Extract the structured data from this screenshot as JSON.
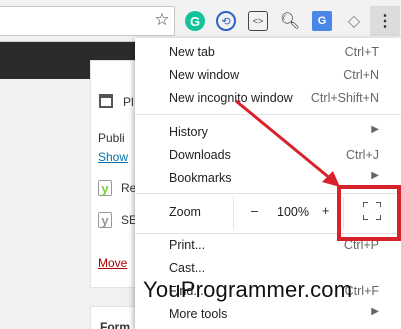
{
  "toolbar": {
    "bookmark_icon": "star-icon",
    "extensions": [
      "grammarly-icon",
      "sync-icon",
      "code-icon",
      "search-icon",
      "translate-icon",
      "tag-icon"
    ],
    "grammarly_letter": "G",
    "menu_icon": "kebab-icon"
  },
  "page": {
    "labels": [
      "Pl",
      "Publi",
      "Show",
      "Re",
      "SE",
      "Move",
      "Form"
    ]
  },
  "menu": {
    "new_tab": {
      "label": "New tab",
      "shortcut": "Ctrl+T"
    },
    "new_window": {
      "label": "New window",
      "shortcut": "Ctrl+N"
    },
    "new_incognito": {
      "label": "New incognito window",
      "shortcut": "Ctrl+Shift+N"
    },
    "history": {
      "label": "History"
    },
    "downloads": {
      "label": "Downloads",
      "shortcut": "Ctrl+J"
    },
    "bookmarks": {
      "label": "Bookmarks"
    },
    "zoom": {
      "label": "Zoom",
      "minus": "–",
      "value": "100%",
      "plus": "+"
    },
    "print": {
      "label": "Print...",
      "shortcut": "Ctrl+P"
    },
    "cast": {
      "label": "Cast..."
    },
    "find": {
      "label": "Find...",
      "shortcut": "Ctrl+F"
    },
    "more_tools": {
      "label": "More tools"
    }
  },
  "annotation": {
    "color": "#d8222a"
  },
  "watermark": "YouProgrammer.com"
}
